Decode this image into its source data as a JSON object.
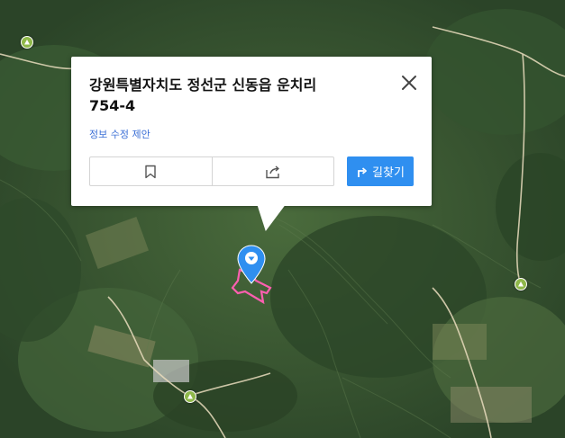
{
  "map": {
    "view": "satellite",
    "colors": {
      "terrain_dark": "#243d24",
      "terrain_mid": "#3c5c34",
      "road": "#e8dcc0",
      "parcel_outline": "#ff5fb0",
      "pin": "#2f8ff0",
      "trail_marker": "#8fb84a"
    }
  },
  "popup": {
    "title_line1": "강원특별자치도 정선군 신동읍 운치리",
    "title_line2": "754-4",
    "suggest_edit_label": "정보 수정 제안",
    "directions_label": "길찾기",
    "close_icon": "close-icon",
    "save_icon": "bookmark-icon",
    "share_icon": "share-icon"
  }
}
